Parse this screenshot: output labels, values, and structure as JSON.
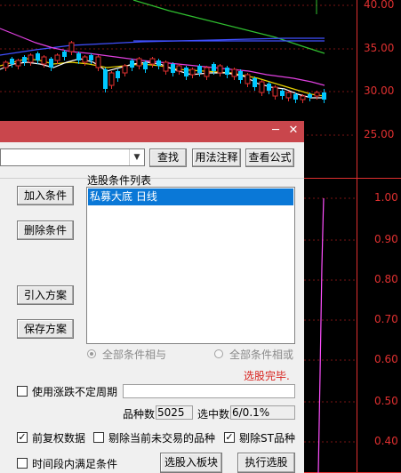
{
  "chart": {
    "price_axis": [
      "40.00",
      "35.00",
      "30.00",
      "25.00"
    ],
    "indicator_axis": [
      "1.00",
      "0.90",
      "0.80",
      "0.70",
      "0.60",
      "0.50",
      "0.40"
    ],
    "colors": {
      "up": "#e03030",
      "down": "#00c8ff",
      "ma_white": "#ffffff",
      "ma_yellow": "#e6d000",
      "ma_magenta": "#e040e0",
      "ma_green": "#2fbf2f",
      "ma_blue": "#4050ff",
      "grid": "#e03030",
      "indicator": "#ff50ff"
    }
  },
  "dialog": {
    "title_buttons": {
      "minimize": "─",
      "close": "✕"
    },
    "combo_value": "",
    "buttons": {
      "find": "查找",
      "usage": "用法注释",
      "view_formula": "查看公式",
      "add_condition": "加入条件",
      "delete_condition": "删除条件",
      "import_plan": "引入方案",
      "save_plan": "保存方案",
      "to_block": "选股入板块",
      "run": "执行选股"
    },
    "list_title": "选股条件列表",
    "conditions": [
      "私募大底  日线"
    ],
    "radio_and": "全部条件相与",
    "radio_or": "全部条件相或",
    "status": "选股完毕.",
    "use_variable_period": "使用涨跌不定周期",
    "variable_period_value": "",
    "count_label": "品种数",
    "count_value": "5025",
    "selected_label": "选中数",
    "selected_value": "6/0.1%",
    "forward_adjust": "前复权数据",
    "exclude_untraded": "剔除当前未交易的品种",
    "exclude_st": "剔除ST品种",
    "time_range": "时间段内满足条件",
    "checkbox_mark": "✓"
  }
}
